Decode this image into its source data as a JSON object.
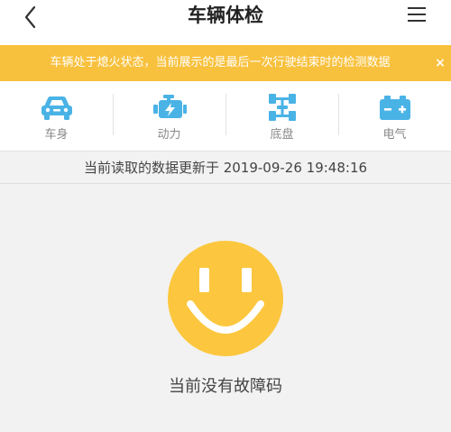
{
  "header": {
    "title": "车辆体检"
  },
  "notice": {
    "text": "车辆处于熄火状态，当前展示的是最后一次行驶结束时的检测数据",
    "close_label": "×"
  },
  "tabs": [
    {
      "label": "车身",
      "icon": "car-body-icon"
    },
    {
      "label": "动力",
      "icon": "engine-icon"
    },
    {
      "label": "底盘",
      "icon": "chassis-icon"
    },
    {
      "label": "电气",
      "icon": "battery-icon"
    }
  ],
  "update": {
    "text": "当前读取的数据更新于 2019-09-26 19:48:16"
  },
  "result": {
    "status_text": "当前没有故障码",
    "icon": "smiley-face-icon"
  },
  "colors": {
    "accent_yellow": "#f8c13d",
    "icon_blue": "#4ab3e6",
    "smiley_yellow": "#fcc73e"
  }
}
